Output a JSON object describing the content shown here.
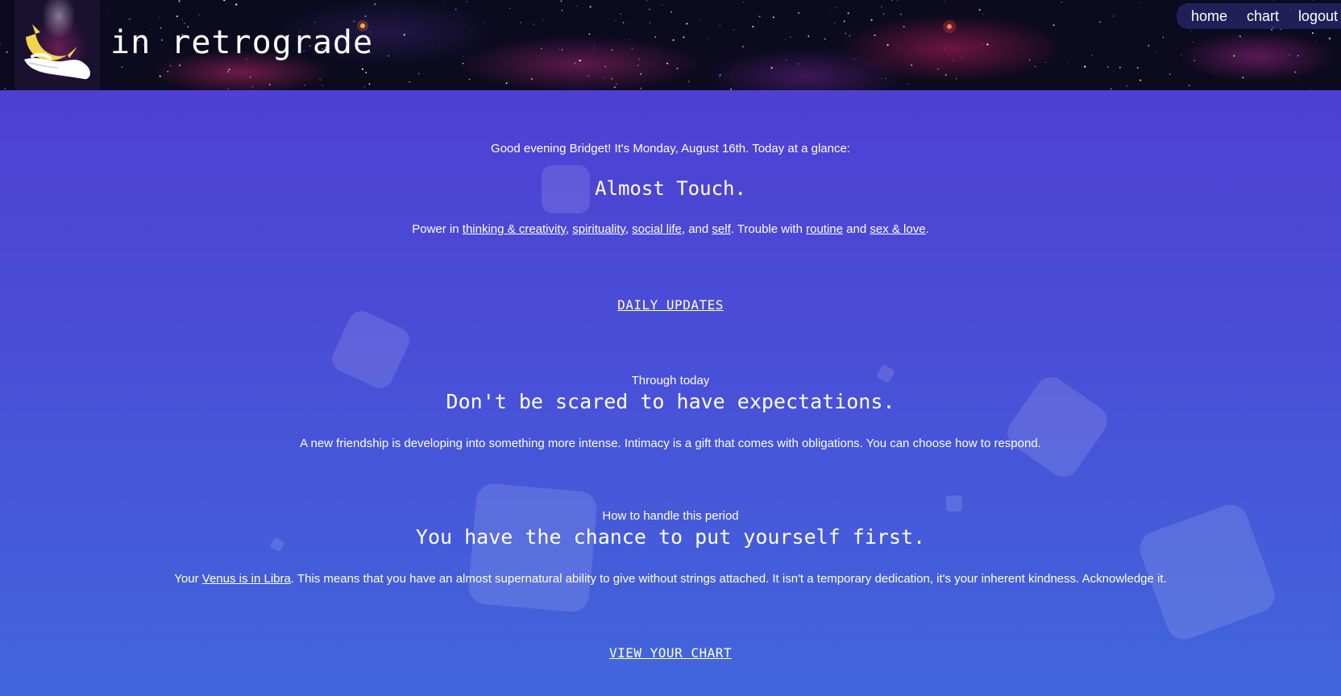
{
  "header": {
    "title": "in retrograde",
    "nav": [
      {
        "label": "home"
      },
      {
        "label": "chart"
      },
      {
        "label": "logout"
      }
    ]
  },
  "main": {
    "greeting": "Good evening Bridget! It's Monday, August 16th. Today at a glance:",
    "headline": "Almost Touch.",
    "power": {
      "prefix": "Power in ",
      "links": [
        "thinking & creativity",
        "spirituality",
        "social life",
        "self"
      ],
      "sep1": ", ",
      "and": ", and ",
      "trouble_prefix": ". Trouble with ",
      "trouble_links": [
        "routine",
        "sex & love"
      ],
      "trouble_and": " and ",
      "end": "."
    },
    "daily_updates_link": "DAILY UPDATES",
    "sections": [
      {
        "label": "Through today",
        "title": "Don't be scared to have expectations.",
        "body": "A new friendship is developing into something more intense. Intimacy is a gift that comes with obligations. You can choose how to respond."
      },
      {
        "label": "How to handle this period",
        "title": "You have the chance to put yourself first.",
        "body_prefix": "Your ",
        "body_link": "Venus is in Libra",
        "body_suffix": ". This means that you have an almost supernatural ability to give without strings attached. It isn't a temporary dedication, it's your inherent kindness. Acknowledge it."
      }
    ],
    "view_chart_link": "VIEW YOUR CHART"
  },
  "colors": {
    "background_top": "#4f3bd2",
    "background_bottom": "#4166dc",
    "header_bg": "#0b0a1e",
    "moon": "#f2d44a"
  },
  "icons": {
    "logo": "moon-in-hand-icon"
  }
}
